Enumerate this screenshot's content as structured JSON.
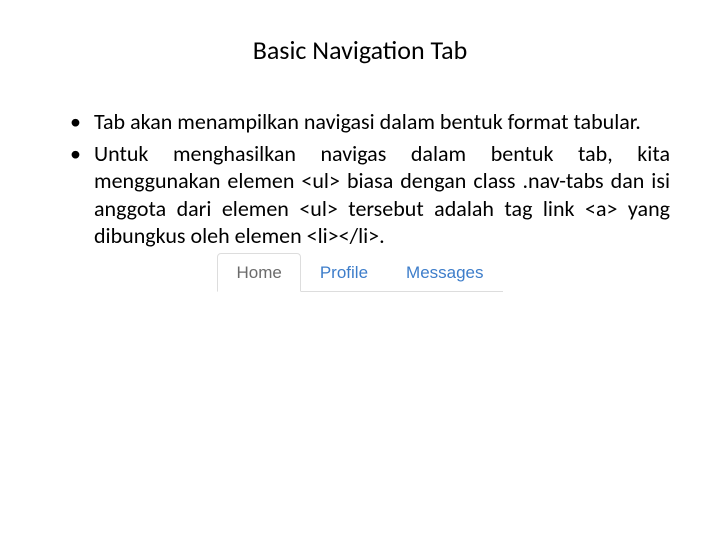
{
  "title": "Basic Navigation Tab",
  "bullets": [
    "Tab akan menampilkan navigasi dalam bentuk format tabular.",
    "Untuk menghasilkan navigas dalam bentuk tab, kita menggunakan elemen <ul> biasa dengan class .nav-tabs dan isi anggota dari elemen <ul> tersebut adalah tag link <a> yang dibungkus oleh elemen <li></li>."
  ],
  "tabs": {
    "items": [
      "Home",
      "Profile",
      "Messages"
    ],
    "active": 0
  }
}
